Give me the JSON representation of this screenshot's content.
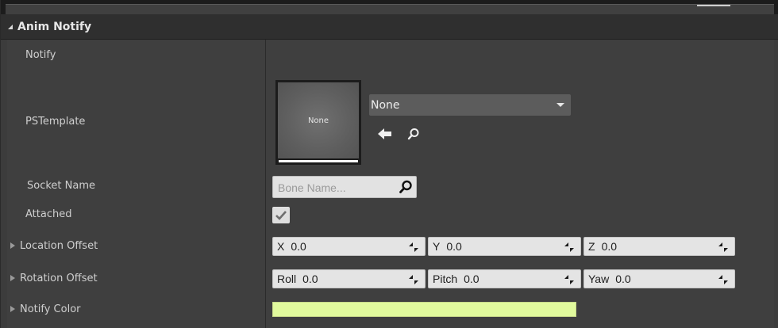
{
  "section": {
    "title": "Anim Notify"
  },
  "rows": {
    "notify": {
      "label": "Notify"
    },
    "ps_template": {
      "label": "PSTemplate",
      "thumbnail_text": "None",
      "combo_value": "None"
    },
    "socket_name": {
      "label": "Socket Name",
      "placeholder": "Bone Name..."
    },
    "attached": {
      "label": "Attached",
      "checked": true
    },
    "location_offset": {
      "label": "Location Offset",
      "x_label": "X",
      "x_value": "0.0",
      "y_label": "Y",
      "y_value": "0.0",
      "z_label": "Z",
      "z_value": "0.0"
    },
    "rotation_offset": {
      "label": "Rotation Offset",
      "roll_label": "Roll",
      "roll_value": "0.0",
      "pitch_label": "Pitch",
      "pitch_value": "0.0",
      "yaw_label": "Yaw",
      "yaw_value": "0.0"
    },
    "notify_color": {
      "label": "Notify Color",
      "color": "#e1fa9d"
    }
  },
  "icons": {
    "back": "arrow-left-icon",
    "browse": "search-icon",
    "expand": "triangle-right-icon",
    "collapse": "triangle-down-icon",
    "spin": "spin-arrows-icon",
    "check": "checkmark-icon"
  }
}
